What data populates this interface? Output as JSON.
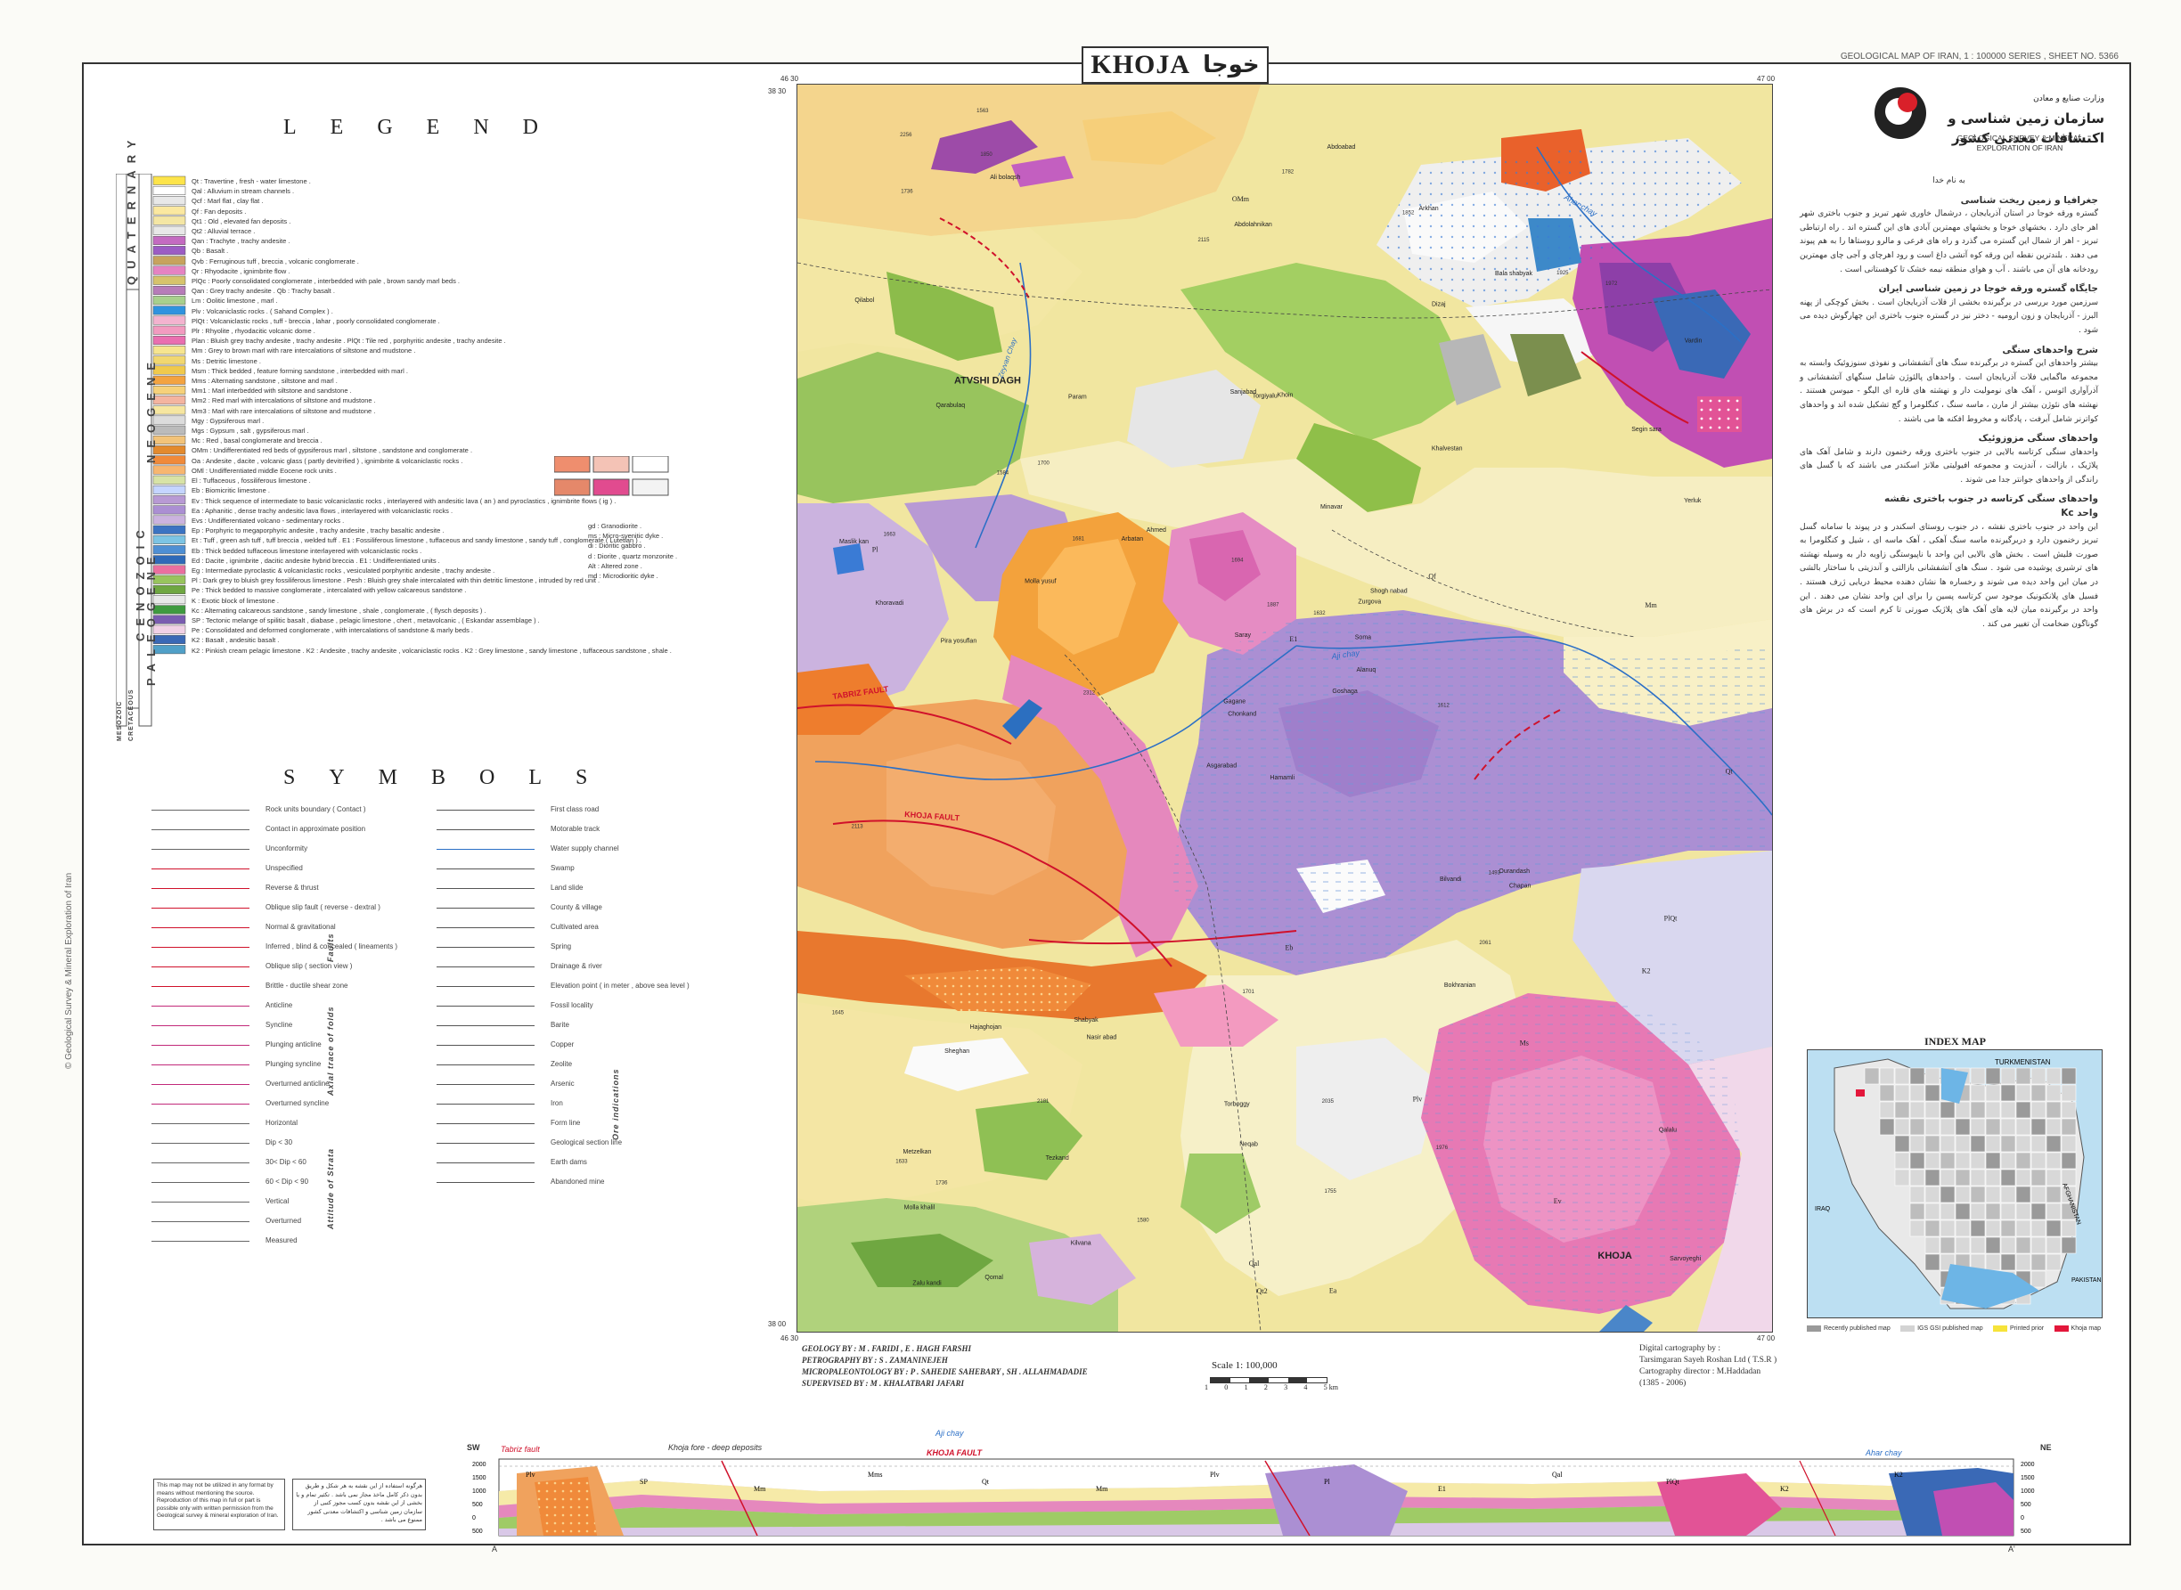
{
  "header": {
    "title_en": "KHOJA",
    "title_fa": "خوجا",
    "series": "GEOLOGICAL MAP OF IRAN, 1 : 100000 SERIES , SHEET NO. 5366"
  },
  "organization": {
    "ministry_fa": "وزارت صنایع و معادن",
    "name_fa": "سازمان زمین شناسی و اکتشافات معدنی کشور",
    "name_en_1": "GEOLOGICAL SURVEY & MINERAL",
    "name_en_2": "EXPLORATION OF IRAN"
  },
  "legend": {
    "heading": "LEGEND",
    "era_quaternary": "QUATERNARY",
    "era_cenozoic": "CENOZOIC",
    "era_neogene": "NEOGENE",
    "era_paleogene": "PALEOGENE",
    "era_mesozoic": "MESOZOIC",
    "era_cretaceous": "CRETACEOUS",
    "entries": [
      "Qt : Travertine , fresh - water limestone .",
      "Qal : Alluvium in stream channels .",
      "Qcf : Marl flat , clay flat .",
      "Qf : Fan deposits .",
      "Qt1 : Old , elevated fan deposits .",
      "Qt2 : Alluvial terrace .",
      "Qan : Trachyte , trachy andesite .",
      "Qb : Basalt .",
      "Qvb : Ferruginous tuff , breccia , volcanic conglomerate .",
      "Qr : Rhyodacite , ignimbrite flow .",
      "PlQc : Poorly consolidated conglomerate , interbedded with pale , brown sandy marl beds .",
      "Qan : Grey trachy andesite .   Qb : Trachy basalt .",
      "Lm : Oolitic limestone , marl .",
      "Plv : Volcaniclastic rocks . ( Sahand Complex ) .",
      "PlQt : Volcaniclastic rocks , tuff - breccia , lahar , poorly consolidated conglomerate .",
      "Plr : Rhyolite , rhyodacitic volcanic dome .",
      "Plan : Bluish grey trachy andesite , trachy andesite .   PlQt : Tile red , porphyritic andesite , trachy andesite .",
      "Mm : Grey to brown marl with rare intercalations of siltstone and mudstone .",
      "Ms : Detritic limestone .",
      "Msm : Thick bedded , feature forming sandstone , interbedded with marl .",
      "Mms : Alternating sandstone , siltstone and marl .",
      "Mm1 : Marl interbedded with siltstone and sandstone .",
      "Mm2 : Red marl with intercalations of siltstone and mudstone .",
      "Mm3 : Marl with rare intercalations of siltstone and mudstone .",
      "Mgy : Gypsiferous marl .",
      "Mgs : Gypsum , salt , gypsiferous marl .",
      "Mc : Red , basal conglomerate and breccia .",
      "OMm : Undifferentiated red beds of gypsiferous marl , siltstone , sandstone and conglomerate .",
      "Oa : Andesite , dacite , volcanic glass ( partly devitrified ) , ignimbrite & volcaniclastic rocks .",
      "OMl : Undifferentiated middle Eocene rock units .",
      "El : Tuffaceous , fossiliferous limestone .",
      "Eb : Biomicritic limestone .",
      "Ev : Thick sequence of intermediate to basic volcaniclastic rocks , interlayered with andesitic lava ( an ) and pyroclastics , ignimbrite flows ( ig ) .",
      "Ea : Aphanitic , dense trachy andesitic lava flows , interlayered with volcaniclastic rocks .",
      "Evs : Undifferentiated volcano - sedimentary rocks .",
      "Ep : Porphyric to megaporphyric andesite , trachy andesite , trachy basaltic andesite .",
      "Et : Tuff , green ash tuff , tuff breccia , welded tuff .   E1 : Fossiliferous limestone , tuffaceous and sandy limestone , sandy tuff , conglomerate ( Lutetian ) .",
      "Eb : Thick bedded tuffaceous limestone interlayered with volcaniclastic rocks .",
      "Ed : Dacite , ignimbrite , dacitic andesite hybrid breccia .   E1 : Undifferentiated units .",
      "Eg : Intermediate pyroclastic & volcaniclastic rocks , vesiculated porphyritic andesite , trachy andesite .",
      "Pl : Dark grey to bluish grey fossiliferous limestone .   Pesh : Bluish grey shale intercalated with thin detritic limestone , intruded by red unit .",
      "Pe : Thick bedded to massive conglomerate , intercalated with yellow calcareous sandstone .",
      "K : Exotic block of limestone .",
      "Kc : Alternating calcareous sandstone , sandy limestone , shale , conglomerate , ( flysch deposits ) .",
      "SP : Tectonic melange of spilitic basalt , diabase , pelagic limestone , chert , metavolcanic , ( Eskandar assemblage ) .",
      "Pe : Consolidated and deformed conglomerate , with intercalations of sandstone & marly beds .",
      "K2 : Basalt , andesitic basalt .",
      "K2 : Pinkish cream pelagic limestone .   K2 : Andesite , trachy andesite , volcaniclastic rocks .   K2 : Grey limestone , sandy limestone , tuffaceous sandstone , shale ."
    ],
    "intrusives": [
      "gd : Granodiorite .",
      "ms : Micro-syenitic dyke .",
      "di : Dioritic gabbro .",
      "d : Diorite , quartz monzonite .",
      "Alt : Altered zone .",
      "md : Microdioritic dyke ."
    ]
  },
  "symbols": {
    "heading": "SYMBOLS",
    "left": [
      "Rock units boundary ( Contact )",
      "Contact in approximate position",
      "Unconformity",
      "Unspecified",
      "Reverse & thrust",
      "Oblique slip fault ( reverse - dextral )",
      "Normal & gravitational",
      "Inferred , blind & concealed ( lineaments )",
      "Oblique slip ( section view )",
      "Brittle - ductile shear zone",
      "Anticline",
      "Syncline",
      "Plunging anticline",
      "Plunging syncline",
      "Overturned anticline",
      "Overturned syncline",
      "Horizontal",
      "Dip < 30",
      "30< Dip < 60",
      "60 < Dip < 90",
      "Vertical",
      "Overturned",
      "Measured"
    ],
    "group_faults": "Faults",
    "group_folds": "Axial trace of folds",
    "group_strata": "Attitude of Strata",
    "right": [
      "First class road",
      "Motorable track",
      "Water supply channel",
      "Swamp",
      "Land slide",
      "County & village",
      "Cultivated area",
      "Spring",
      "Drainage & river",
      "Elevation point ( in meter , above sea level )",
      "Fossil locality",
      "Barite",
      "Copper",
      "Zeolite",
      "Arsenic",
      "Iron",
      "Form line",
      "Geological section line",
      "Earth dams",
      "Abandoned mine"
    ],
    "ore_codes": [
      "Ba",
      "Cu",
      "Ze",
      "As",
      "Fe"
    ],
    "elevation_sample": "2873",
    "group_ore": "Ore indications"
  },
  "map": {
    "coords": {
      "top_left": "46 30",
      "top_right": "47 00",
      "bottom_left": "46 30",
      "bottom_right": "47 00",
      "lat_top": "38 30",
      "lat_bottom": "38 00"
    },
    "places": [
      "Hamamli",
      "Qarabulaq",
      "Chonkand",
      "Metzelkan",
      "Zurgova",
      "Nasir abad",
      "Arkhan",
      "Khoin",
      "Dizaj",
      "Goshaga",
      "Ali bolaqsh",
      "Sarvoyeghi",
      "Pira yosuflan",
      "Vardin",
      "Asgarabad",
      "Khalvestan",
      "Qomal",
      "Sanjabad",
      "Minavar",
      "Hajaghojan",
      "Ahmed",
      "Molla khalil",
      "Tezkand",
      "Torgiyalu",
      "Shogh nabad",
      "Chapan",
      "ATVSHI DAGH",
      "Abdolahnikan",
      "Khoravadi",
      "Bilvandi",
      "Yerluk",
      "Gagane",
      "Torboggy",
      "Saray",
      "Param",
      "Bala shabyak",
      "Shabyak",
      "KHOJA",
      "Qalalu",
      "Ourandash",
      "Abdoabad",
      "Arbatan",
      "Molla yusuf",
      "Bokhranian",
      "Kilvana",
      "Maslik kan",
      "Soma",
      "Zalu kandi",
      "Neqab",
      "Alanuq",
      "Sheghan",
      "Segin sara",
      "Qilabol"
    ],
    "rivers": [
      "Ahar chay",
      "Aji chay",
      "Zeyvan Chay"
    ],
    "faults": [
      "TABRIZ FAULT",
      "KHOJA FAULT"
    ],
    "elevations": [
      "2061",
      "1976",
      "2181",
      "1850",
      "2256",
      "2035",
      "1972",
      "1782",
      "2312",
      "1663",
      "1700",
      "1925",
      "1563",
      "1852",
      "2115",
      "1887",
      "1645",
      "1701",
      "1580",
      "1493",
      "1681",
      "1633",
      "1736",
      "1584",
      "2113",
      "1694",
      "1755",
      "1632",
      "1736",
      "1612"
    ],
    "units": [
      "PlQt",
      "Qal",
      "Mm",
      "Eb",
      "Ev",
      "Ea",
      "Plv",
      "OMm",
      "Qt",
      "Qf",
      "Ms",
      "E1",
      "K2",
      "Pl",
      "Qt2"
    ]
  },
  "credits": {
    "geology": "GEOLOGY BY : M . FARIDI , E . HAGH FARSHI",
    "petrography": "PETROGRAPHY BY : S . ZAMANINEJEH",
    "micropaleontology": "MICROPALEONTOLOGY BY : P . SAHEDIE SAHEBARY , SH . ALLAHMADADIE",
    "supervised": "SUPERVISED BY : M . KHALATBARI JAFARI",
    "digital": "Digital cartography by :",
    "company": "Tarsimgaran Sayeh Roshan Ltd ( T.S.R )",
    "director": "Cartography director : M.Haddadan",
    "date": "(1385 - 2006)"
  },
  "scale": {
    "label": "Scale 1: 100,000",
    "ticks": [
      "1",
      "0",
      "1",
      "2",
      "3",
      "4",
      "5 km"
    ]
  },
  "index_map": {
    "title": "INDEX MAP",
    "countries": [
      "TURKMENISTAN",
      "AFGHANISTAN",
      "PAKISTAN",
      "IRAQ"
    ],
    "keys": [
      "Recently published map",
      "IGS GSI published map",
      "Printed prior",
      "Khoja map"
    ]
  },
  "persian_text": {
    "basmala": "به نام خدا",
    "h1": "جغرافیا و زمین ریخت شناسی",
    "p1": "گستره ورقه خوجا در استان آذربایجان ، درشمال خاوری شهر تبریز و جنوب باختری شهر اهر جای دارد . بخشهای خوجا و بخشهای مهمترین آبادی های این گستره اند . راه ارتباطی تبریز - اهر از شمال این گستره می گذرد و راه های فرعی و مالرو روستاها را به هم پیوند می دهند . بلندترین نقطه این ورقه کوه آتشی داغ است و رود اهرچای و آجی چای مهمترین رودخانه های آن می باشند . آب و هوای منطقه نیمه خشک تا کوهستانی است .",
    "h2": "جایگاه گستره ورقه خوجا در زمین شناسی ایران",
    "p2": "سرزمین مورد بررسی در برگیرنده بخشی از فلات آذربایجان است . بخش کوچکی از پهنه البرز - آذربایجان و زون ارومیه - دختر نیز در گستره جنوب باختری این چهارگوش دیده می شود .",
    "h3": "شرح واحدهای سنگی",
    "p3": "بیشتر واحدهای این گستره در برگیرنده سنگ های آتشفشانی و نفوذی سنوزوئیک وابسته به مجموعه ماگمایی فلات آذربایجان است . واحدهای پالئوژن شامل سنگهای آتشفشانی و آذرآواری ائوسن ، آهک های نومولیت دار و نهشته های قاره ای الیگو - میوسن هستند . نهشته های نئوژن بیشتر از مارن ، ماسه سنگ ، کنگلومرا و گچ تشکیل شده اند و واحدهای کواترنر شامل آبرفت ، پادگانه و مخروط افکنه ها می باشند .",
    "h4": "واحدهای سنگی مزوزوئیک",
    "p4": "واحدهای سنگی کرتاسه بالایی در جنوب باختری ورقه رخنمون دارند و شامل آهک های پلاژیک ، بازالت ، آندزیت و مجموعه افیولیتی ملانژ اسکندر می باشند که با گسل های راندگی از واحدهای جوانتر جدا می شوند .",
    "h5": "واحدهای سنگی کرتاسه در جنوب باختری نقشه",
    "h5b": "واحد Kc",
    "p5": "این واحد در جنوب باختری نقشه ، در جنوب روستای اسکندر و در پیوند با سامانه گسل تبریز رخنمون دارد و دربرگیرنده ماسه سنگ آهکی ، آهک ماسه ای ، شیل و کنگلومرا به صورت فلیش است . بخش های بالایی این واحد با ناپیوستگی زاویه دار به وسیله نهشته های ترشیری پوشیده می شود . سنگ های آتشفشانی بازالتی و آندزیتی با ساختار بالشی در میان این واحد دیده می شوند و رخساره ها نشان دهنده محیط دریایی ژرف هستند . فسیل های پلانکتونیک موجود سن کرتاسه پسین را برای این واحد نشان می دهند . این واحد در برگیرنده میان لایه های آهک های پلاژیک صورتی تا کرم است که در برش های گوناگون ضخامت آن تغییر می کند ."
  },
  "section": {
    "sw": "SW",
    "ne": "NE",
    "a_left": "A",
    "a_right": "A'",
    "labels": [
      "Tabriz fault",
      "Khoja fore - deep deposits",
      "Aji chay",
      "KHOJA FAULT",
      "Ahar chay"
    ],
    "units": [
      "Plv",
      "SP",
      "Mm",
      "Mms",
      "Qt",
      "Mm",
      "Plv",
      "Pl",
      "E1",
      "Qal",
      "PlQt",
      "K2",
      "K2"
    ],
    "y_ticks_left": [
      "2000",
      "1500",
      "1000",
      "500",
      "0",
      "500"
    ],
    "y_ticks_right": [
      "2000",
      "1500",
      "1000",
      "500",
      "0",
      "500"
    ]
  },
  "notice": {
    "en": "This map may not be utilized in any format by means without mentioning the source. Reproduction of this map in full or part is possible only with written permission from the Geological survey & mineral exploration of Iran.",
    "fa": "هرگونه استفاده از این نقشه به هر شکل و طریق بدون ذکر کامل ماخذ مجاز نمی باشد . تکثیر تمام و یا بخشی از این نقشه بدون کسب مجوز کتبی از سازمان زمین شناسی و اکتشافات معدنی کشور ممنوع می باشد ."
  },
  "side_text": "© Geological Survey & Mineral Exploration of Iran"
}
